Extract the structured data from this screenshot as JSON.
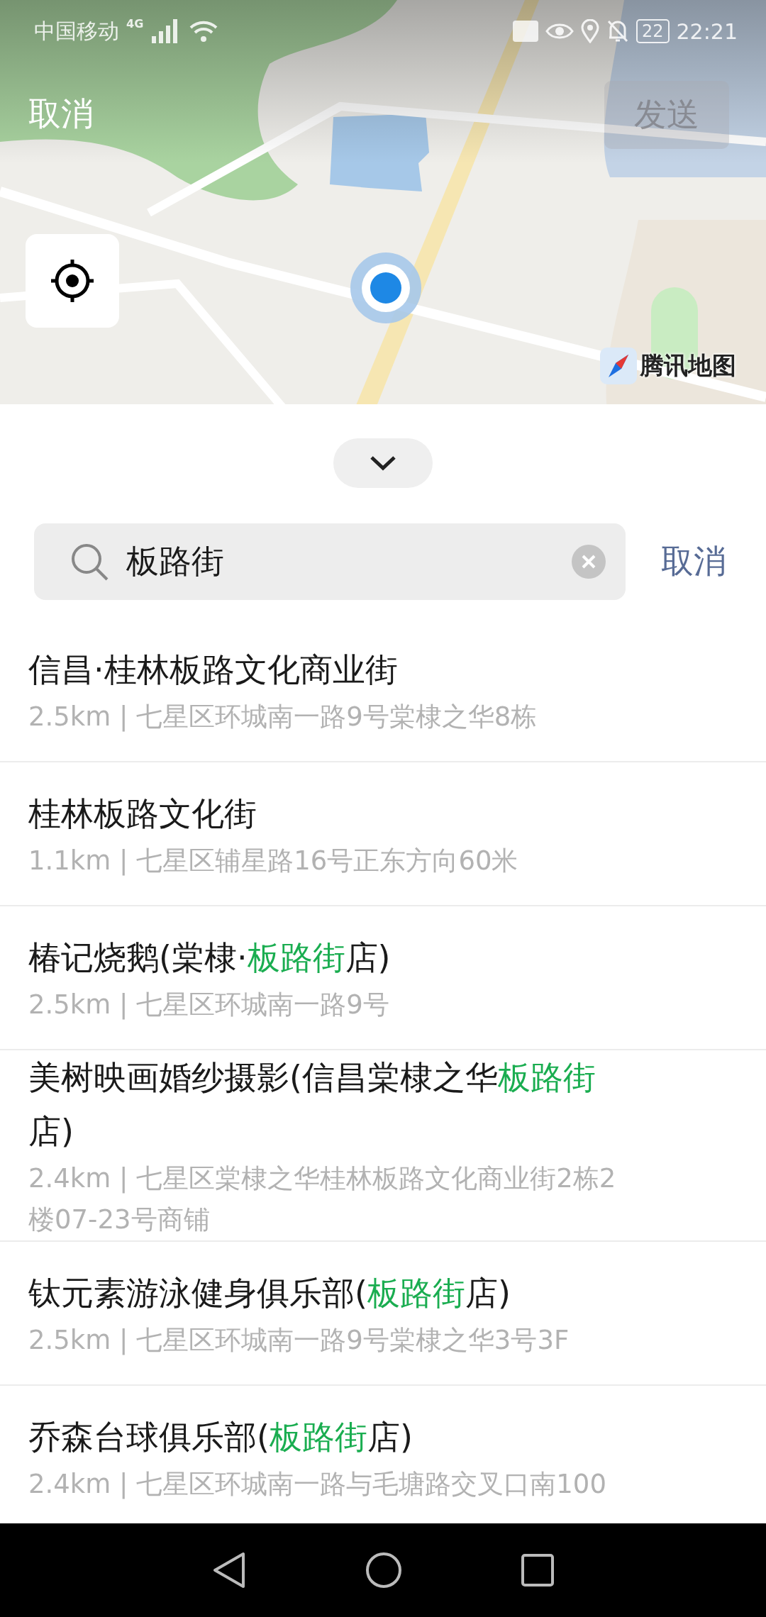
{
  "status_bar": {
    "carrier": "中国移动",
    "network": "4G",
    "battery": "22",
    "time": "22:21"
  },
  "map": {
    "kind": "picture",
    "cancel": "取消",
    "send": {
      "label": "发送",
      "disabled": true
    },
    "logo": "腾讯地图"
  },
  "search": {
    "value": "板路街",
    "cancel": "取消"
  },
  "results": [
    {
      "title": [
        {
          "text": "信昌·桂林板路文化商业街",
          "highlight": false
        }
      ],
      "detail": "2.5km | 七星区环城南一路9号棠棣之华8栋"
    },
    {
      "title": [
        {
          "text": "桂林板路文化街",
          "highlight": false
        }
      ],
      "detail": "1.1km | 七星区辅星路16号正东方向60米"
    },
    {
      "title": [
        {
          "text": "椿记烧鹅(棠棣·",
          "highlight": false
        },
        {
          "text": "板路街",
          "highlight": true
        },
        {
          "text": "店)",
          "highlight": false
        }
      ],
      "detail": "2.5km | 七星区环城南一路9号"
    },
    {
      "title": [
        {
          "text": "美树映画婚纱摄影(信昌棠棣之华",
          "highlight": false
        },
        {
          "text": "板路街",
          "highlight": true
        },
        {
          "text": "店)",
          "highlight": false
        }
      ],
      "detail": "2.4km | 七星区棠棣之华桂林板路文化商业街2栋2楼07-23号商铺"
    },
    {
      "title": [
        {
          "text": "钛元素游泳健身俱乐部(",
          "highlight": false
        },
        {
          "text": "板路街",
          "highlight": true
        },
        {
          "text": "店)",
          "highlight": false
        }
      ],
      "detail": "2.5km | 七星区环城南一路9号棠棣之华3号3F"
    },
    {
      "title": [
        {
          "text": "乔森台球俱乐部(",
          "highlight": false
        },
        {
          "text": "板路街",
          "highlight": true
        },
        {
          "text": "店)",
          "highlight": false
        }
      ],
      "detail": "2.4km | 七星区环城南一路与毛塘路交叉口南100"
    }
  ]
}
